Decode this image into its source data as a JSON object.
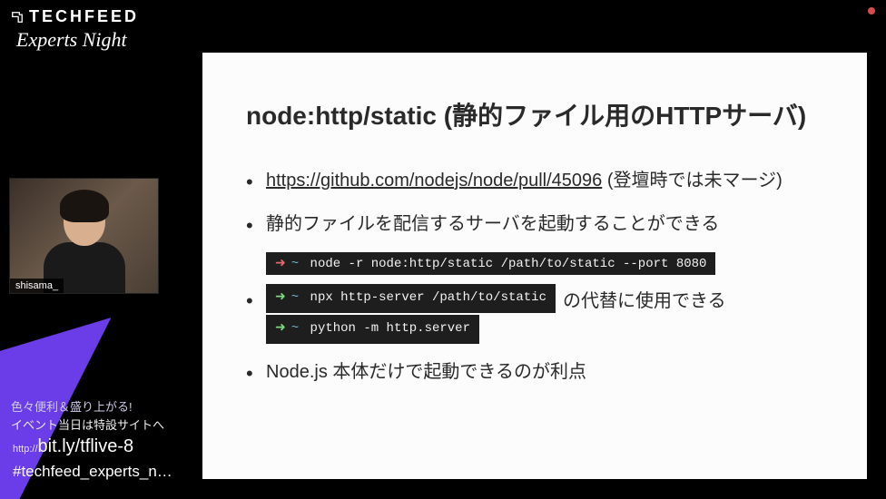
{
  "header": {
    "brand": "TECHFEED",
    "event_subtitle": "Experts Night"
  },
  "webcam": {
    "speaker_name": "shisama_"
  },
  "promo": {
    "line1": "色々便利＆盛り上がる!",
    "line2": "イベント当日は特設サイトへ",
    "url_prefix": "http://",
    "url_main": "bit.ly/tflive-8",
    "hashtag": "#techfeed_experts_n…"
  },
  "slide": {
    "title": "node:http/static (静的ファイル用のHTTPサーバ)",
    "bullets": {
      "b1": {
        "link": "https://github.com/nodejs/node/pull/45096",
        "suffix": " (登壇時では未マージ)"
      },
      "b2": "静的ファイルを配信するサーバを起動することができる",
      "cmd1": "node -r node:http/static /path/to/static --port 8080",
      "b3_code_a": "npx http-server /path/to/static",
      "b3_suffix": " の代替に使用できる",
      "b3_code_b": "python -m http.server",
      "b4": "Node.js 本体だけで起動できるのが利点"
    }
  }
}
